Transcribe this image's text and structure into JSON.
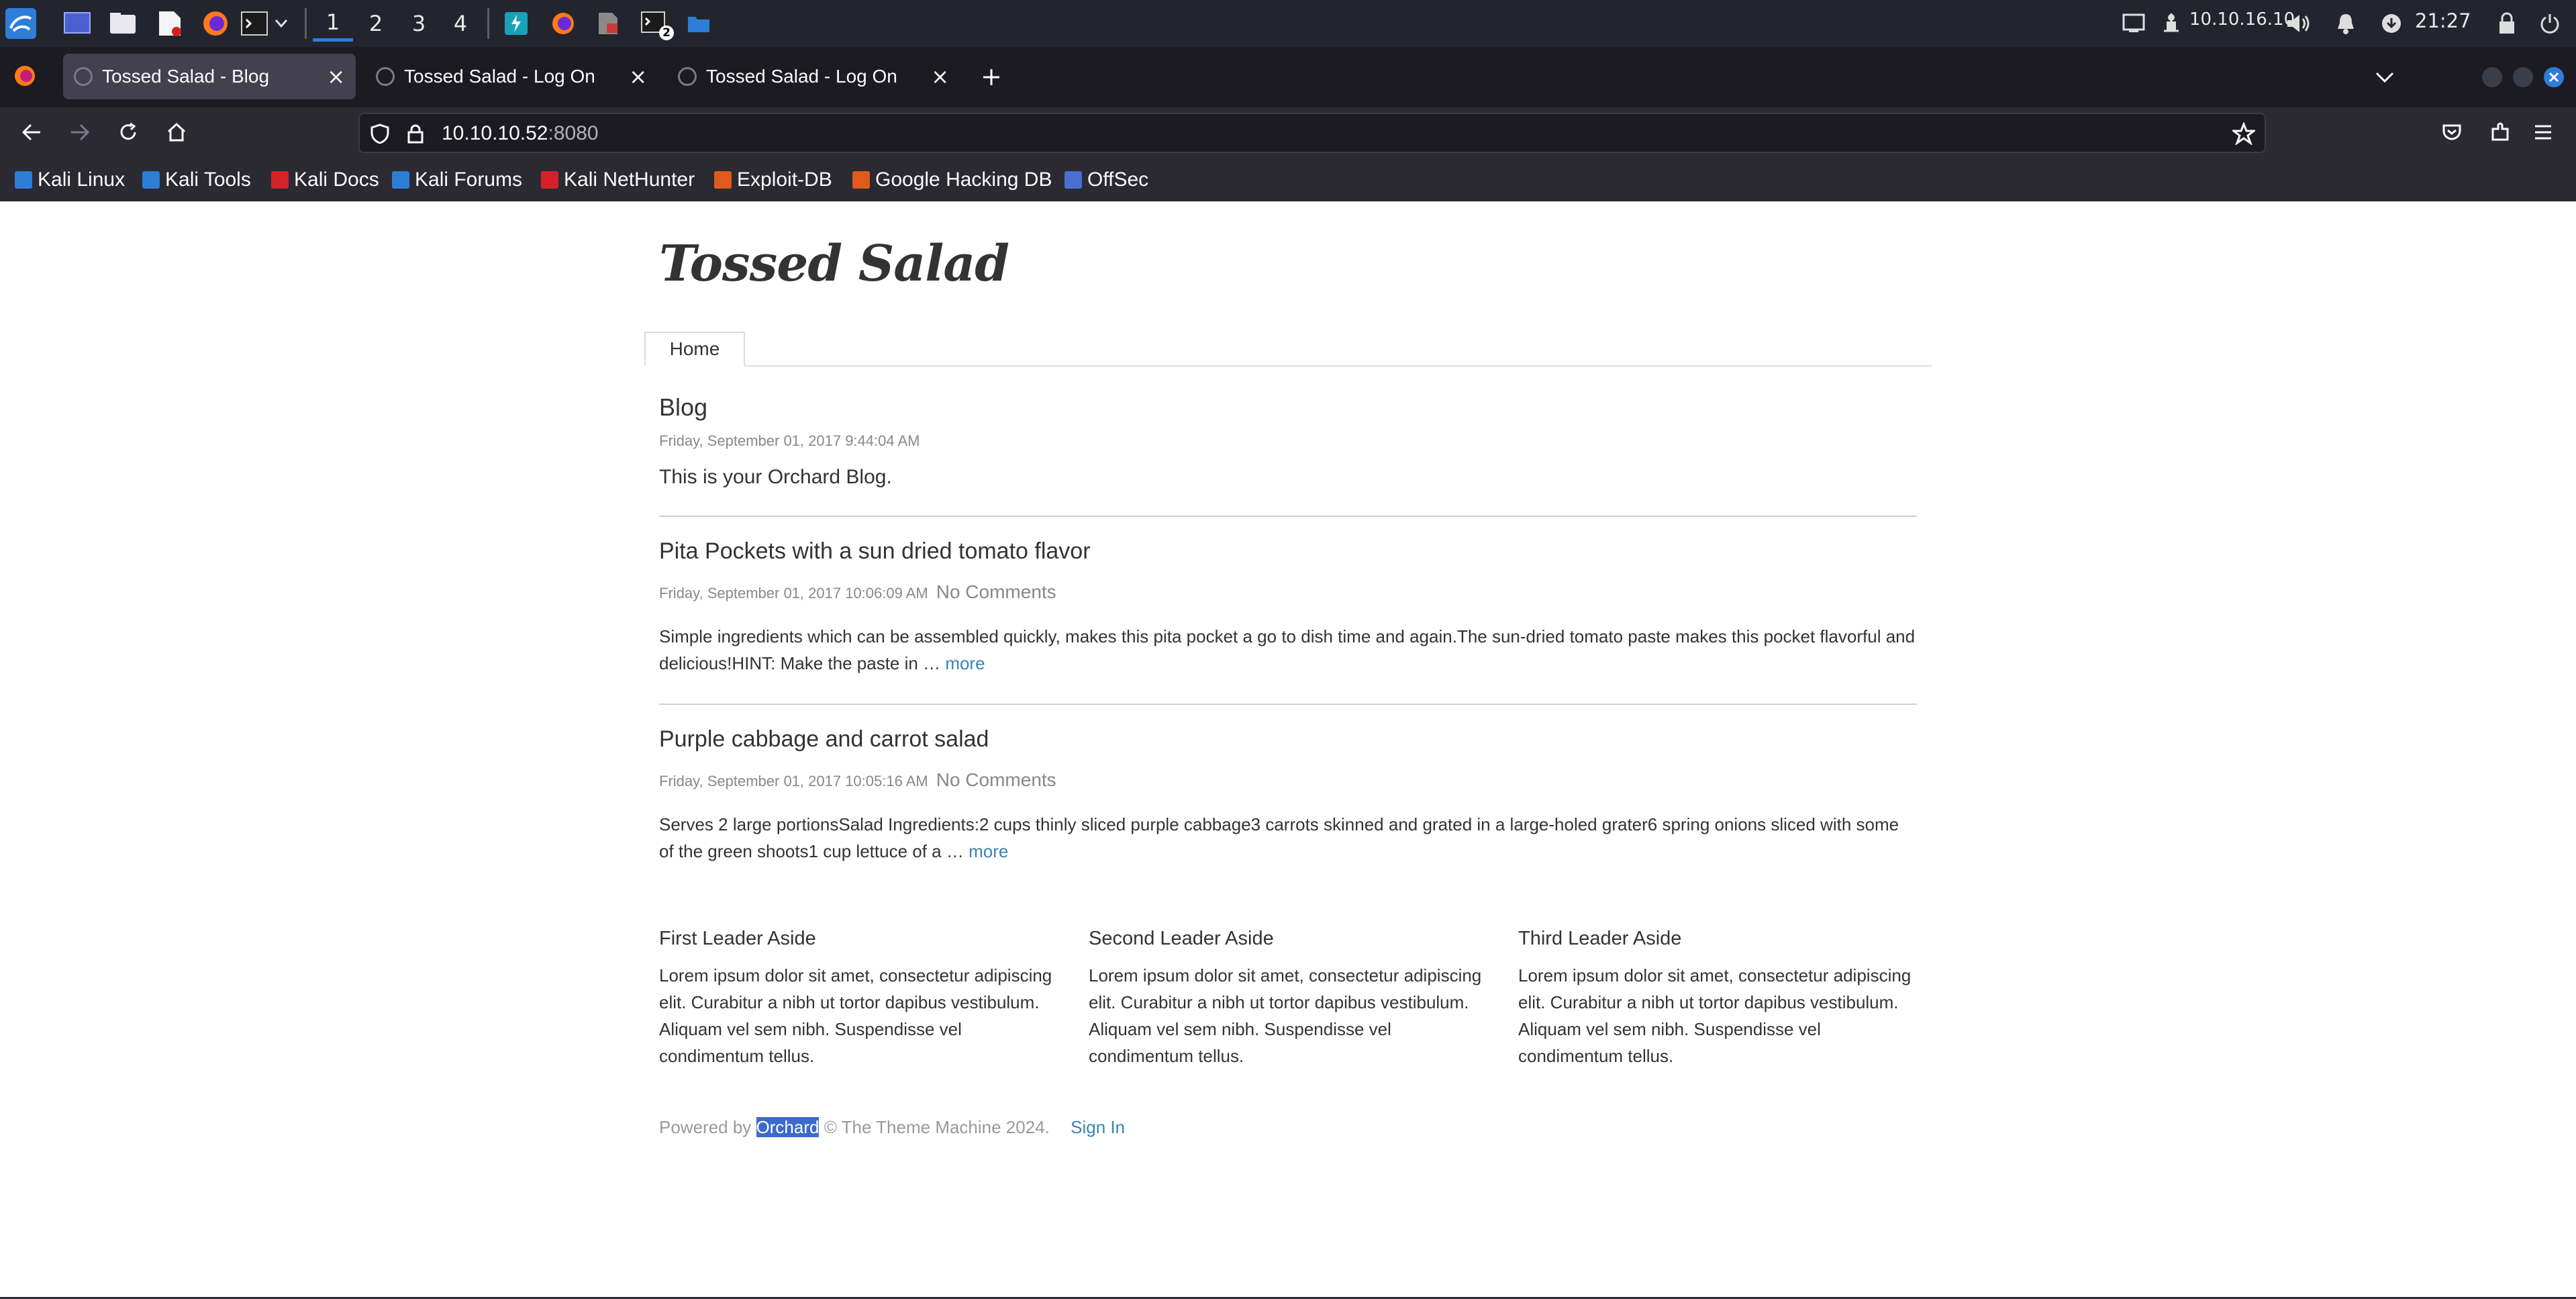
{
  "panel": {
    "workspaces": [
      "1",
      "2",
      "3",
      "4"
    ],
    "terminal_badge": "2",
    "ip": "10.10.16.10",
    "clock": "21:27",
    "icons": [
      "kali-menu-icon",
      "desktop-icon",
      "file-manager-icon",
      "text-editor-icon",
      "firefox-icon",
      "terminal-icon",
      "chevron-down-icon",
      "burp-icon",
      "firefox-icon",
      "pdf-icon",
      "terminal-icon",
      "folder-icon",
      "display-icon",
      "network-icon",
      "volume-icon",
      "bell-icon",
      "update-icon",
      "lock-icon",
      "power-icon"
    ]
  },
  "browser": {
    "tabs": [
      {
        "title": "Tossed Salad - Blog",
        "active": true
      },
      {
        "title": "Tossed Salad - Log On",
        "active": false
      },
      {
        "title": "Tossed Salad - Log On",
        "active": false
      }
    ],
    "url_host": "10.10.10.52",
    "url_port": ":8080",
    "bookmarks": [
      {
        "label": "Kali Linux",
        "color": "#2e7dd7"
      },
      {
        "label": "Kali Tools",
        "color": "#2e7dd7"
      },
      {
        "label": "Kali Docs",
        "color": "#d3222a"
      },
      {
        "label": "Kali Forums",
        "color": "#2e7dd7"
      },
      {
        "label": "Kali NetHunter",
        "color": "#d3222a"
      },
      {
        "label": "Exploit-DB",
        "color": "#e05a1c"
      },
      {
        "label": "Google Hacking DB",
        "color": "#e05a1c"
      },
      {
        "label": "OffSec",
        "color": "#4a6fd1"
      }
    ]
  },
  "site": {
    "title": "Tossed Salad",
    "menu": [
      "Home"
    ],
    "blog": {
      "heading": "Blog",
      "date": "Friday, September 01, 2017 9:44:04 AM",
      "lead": "This is your Orchard Blog."
    },
    "posts": [
      {
        "title": "Pita Pockets with a sun dried tomato flavor",
        "date": "Friday, September 01, 2017 10:06:09 AM",
        "comments": "No Comments",
        "excerpt": "Simple ingredients which can be assembled quickly, makes this pita pocket a go to dish time and again.The sun-dried tomato paste makes this pocket flavorful and delicious!HINT:  Make the paste in …",
        "more": "more"
      },
      {
        "title": "Purple cabbage and carrot salad",
        "date": "Friday, September 01, 2017 10:05:16 AM",
        "comments": "No Comments",
        "excerpt": "Serves 2 large portionsSalad Ingredients:2 cups thinly sliced purple cabbage3 carrots skinned and grated in a large-holed grater6 spring onions sliced with some of the green shoots1 cup lettuce of a …",
        "more": "more"
      }
    ],
    "asides": [
      {
        "title": "First Leader Aside",
        "text": "Lorem ipsum dolor sit amet, consectetur adipiscing elit. Curabitur a nibh ut tortor dapibus vestibulum. Aliquam vel sem nibh. Suspendisse vel condimentum tellus."
      },
      {
        "title": "Second Leader Aside",
        "text": "Lorem ipsum dolor sit amet, consectetur adipiscing elit. Curabitur a nibh ut tortor dapibus vestibulum. Aliquam vel sem nibh. Suspendisse vel condimentum tellus."
      },
      {
        "title": "Third Leader Aside",
        "text": "Lorem ipsum dolor sit amet, consectetur adipiscing elit. Curabitur a nibh ut tortor dapibus vestibulum. Aliquam vel sem nibh. Suspendisse vel condimentum tellus."
      }
    ],
    "footer": {
      "powered_by": "Powered by",
      "orchard": "Orchard",
      "copyright": "© The Theme Machine 2024.",
      "sign_in": "Sign In"
    }
  }
}
